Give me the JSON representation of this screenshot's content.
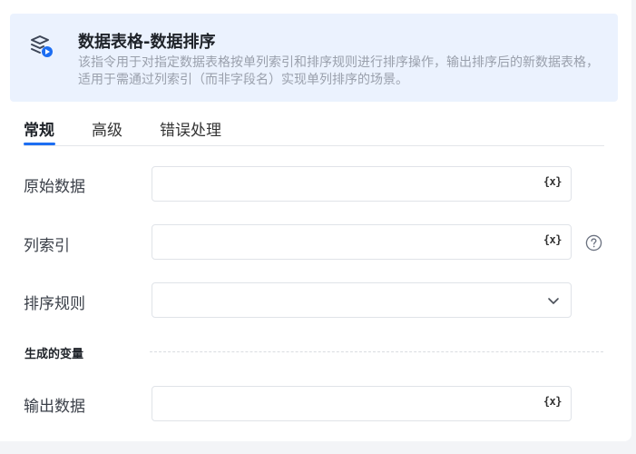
{
  "header": {
    "title": "数据表格-数据排序",
    "description": "该指令用于对指定数据表格按单列索引和排序规则进行排序操作，输出排序后的新数据表格，适用于需通过列索引（而非字段名）实现单列排序的场景。",
    "icon": "data-sort-icon",
    "accent_color": "#1d6ef2"
  },
  "tabs": [
    {
      "label": "常规",
      "active": true
    },
    {
      "label": "高级",
      "active": false
    },
    {
      "label": "错误处理",
      "active": false
    }
  ],
  "fields": {
    "source_data": {
      "label": "原始数据",
      "value": "",
      "icon": "{x}"
    },
    "column_index": {
      "label": "列索引",
      "value": "",
      "icon": "{x}"
    },
    "sort_rule": {
      "label": "排序规则",
      "value": ""
    }
  },
  "generated_variables": {
    "title": "生成的变量",
    "output_data": {
      "label": "输出数据",
      "value": "",
      "icon": "{x}"
    }
  }
}
